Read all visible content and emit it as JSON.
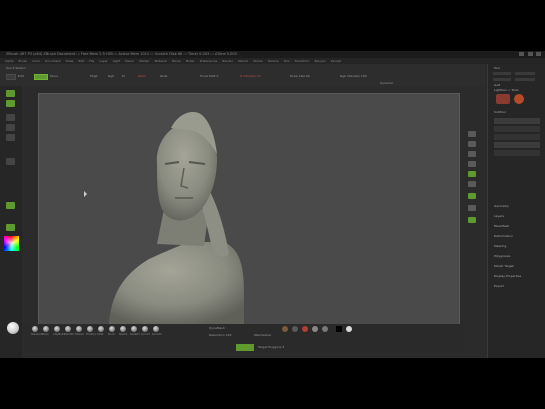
{
  "app": {
    "title": "ZBrush 4R7 P3 (x64) ZBrush Document ::: Free Mem 2.5+GB ::: Active Mem 1012 ::: Scratch Disk 66 ::: Timer 0.003 ::: ATime 0.003"
  },
  "menu": [
    "Alpha",
    "Brush",
    "Color",
    "Document",
    "Draw",
    "Edit",
    "File",
    "Layer",
    "Light",
    "Macro",
    "Marker",
    "Material",
    "Movie",
    "Picker",
    "Preferences",
    "Render",
    "Stencil",
    "Stroke",
    "Texture",
    "Tool",
    "Transform",
    "Zplugin",
    "Zscript"
  ],
  "topbar": {
    "projection_label": "Quick Sketch",
    "edit_label": "Edit",
    "draw_label": "Draw",
    "move_label": "Move",
    "mrgb_label": "Mrgb",
    "rgb_label": "Rgb",
    "m_label": "M",
    "zadd_label": "Zadd",
    "zsub_label": "Zsub",
    "focal_label": "Focal Shift 0",
    "intensity_label": "Z Intensity 25",
    "draw_size_label": "Draw Size 64",
    "rgb_intensity_label": "Rgb Intensity 100",
    "dynamic_label": "Dynamic"
  },
  "right_panel": {
    "title": "Tool",
    "load_label": "Load Tool",
    "save_label": "Save As",
    "import_label": "Import",
    "export_label": "Export",
    "goz_label": "GoZ",
    "all_label": "All",
    "visible_label": "Visible",
    "r_label": "R",
    "lightbox_label": "Lightbox > Tools",
    "subtool_label": "SubTool",
    "geometry_label": "Geometry",
    "layers_label": "Layers",
    "fibermesh_label": "FiberMesh",
    "deformation_label": "Deformation",
    "masking_label": "Masking",
    "polygroups_label": "Polygroups",
    "morph_label": "Morph Target",
    "display_label": "Display Properties",
    "export_mesh_label": "Export"
  },
  "left_bar": {
    "colors": {
      "accent": "#5e9a2e",
      "grey": "#555555"
    }
  },
  "bottom": {
    "brushes": [
      "Standard",
      "Move",
      "ClayBuild",
      "DamStd",
      "hPolish",
      "TrimDyn",
      "Inflat",
      "Pinch",
      "Slash3",
      "SnakeH",
      "CurveT",
      "Smooth"
    ],
    "dynamesh_label": "DynaMesh",
    "resolution_label": "Resolution 128",
    "backface_label": "BackfaceMask",
    "zremesher_label": "ZRemesher",
    "target_label": "Target Polygons 5",
    "divide_label": "Divide"
  },
  "colors": {
    "canvas": "#4a4a4a",
    "accent": "#5e9a2e",
    "clay": "#8f9086"
  }
}
